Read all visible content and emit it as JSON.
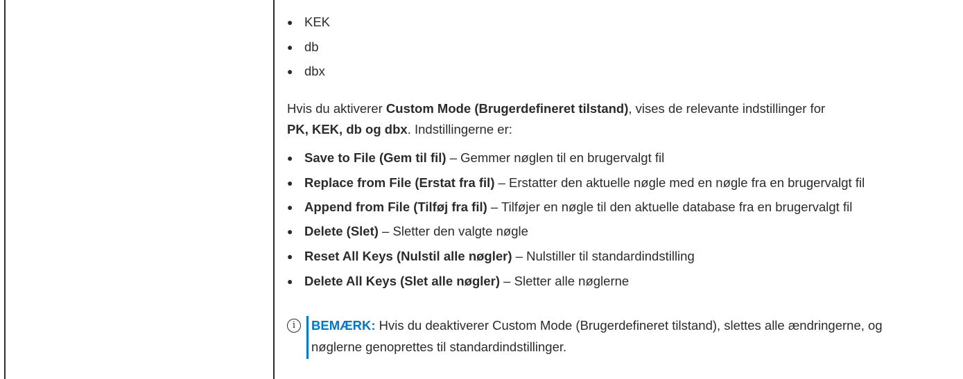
{
  "top_list": [
    "KEK",
    "db",
    "dbx"
  ],
  "intro": {
    "part1": "Hvis du aktiverer ",
    "bold1": "Custom Mode (Brugerdefineret tilstand)",
    "part2": ", vises de relevante indstillinger for",
    "bold2": "PK, KEK, db og dbx",
    "part3": ". Indstillingerne er:"
  },
  "options": [
    {
      "name": "Save to File (Gem til fil)",
      "desc": " – Gemmer nøglen til en brugervalgt fil"
    },
    {
      "name": "Replace from File (Erstat fra fil)",
      "desc": " – Erstatter den aktuelle nøgle med en nøgle fra en brugervalgt fil"
    },
    {
      "name": "Append from File (Tilføj fra fil)",
      "desc": " – Tilføjer en nøgle til den aktuelle database fra en brugervalgt fil"
    },
    {
      "name": "Delete (Slet)",
      "desc": " – Sletter den valgte nøgle"
    },
    {
      "name": "Reset All Keys (Nulstil alle nøgler)",
      "desc": " – Nulstiller til standardindstilling"
    },
    {
      "name": "Delete All Keys (Slet alle nøgler)",
      "desc": " – Sletter alle nøglerne"
    }
  ],
  "note": {
    "label": "BEMÆRK:",
    "text": " Hvis du deaktiverer Custom Mode (Brugerdefineret tilstand), slettes alle ændringerne, og nøglerne genoprettes til standardindstillinger."
  },
  "bullet_char": "●",
  "accent_color": "#0076ce"
}
